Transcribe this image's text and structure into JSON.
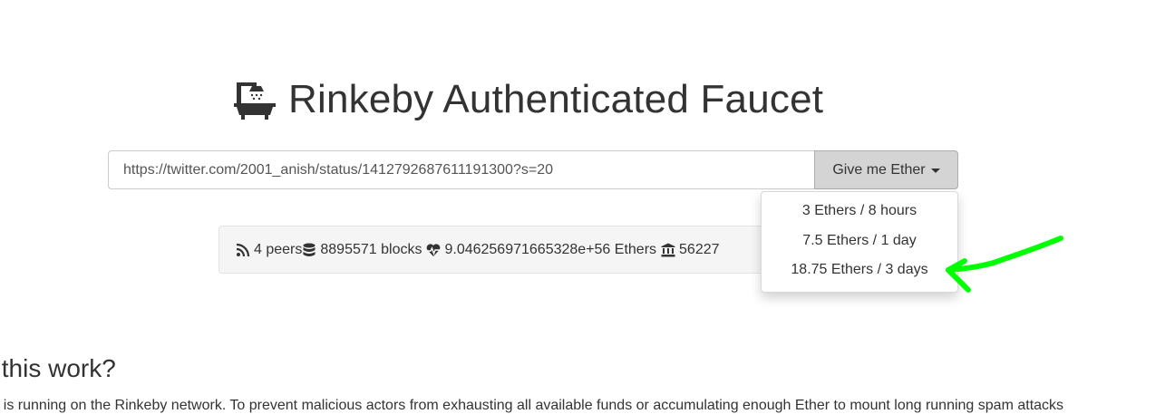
{
  "title": {
    "icon": "bath-icon",
    "text": "Rinkeby Authenticated Faucet"
  },
  "form": {
    "url_value": "https://twitter.com/2001_anish/status/1412792687611191300?s=20",
    "button_label": "Give me Ether"
  },
  "dropdown": {
    "items": [
      {
        "label": "3 Ethers / 8 hours"
      },
      {
        "label": "7.5 Ethers / 1 day"
      },
      {
        "label": "18.75 Ethers / 3 days"
      }
    ]
  },
  "stats": {
    "peers": "4 peers",
    "blocks": "8895571 blocks",
    "funds": "9.046256971665328e+56 Ethers",
    "funded": "56227"
  },
  "section": {
    "heading": "s this work?",
    "paragraph": "et is running on the Rinkeby network. To prevent malicious actors from exhausting all available funds or accumulating enough Ether to mount long running spam attacks"
  },
  "annotation": {
    "arrow_color": "#00ff00"
  }
}
